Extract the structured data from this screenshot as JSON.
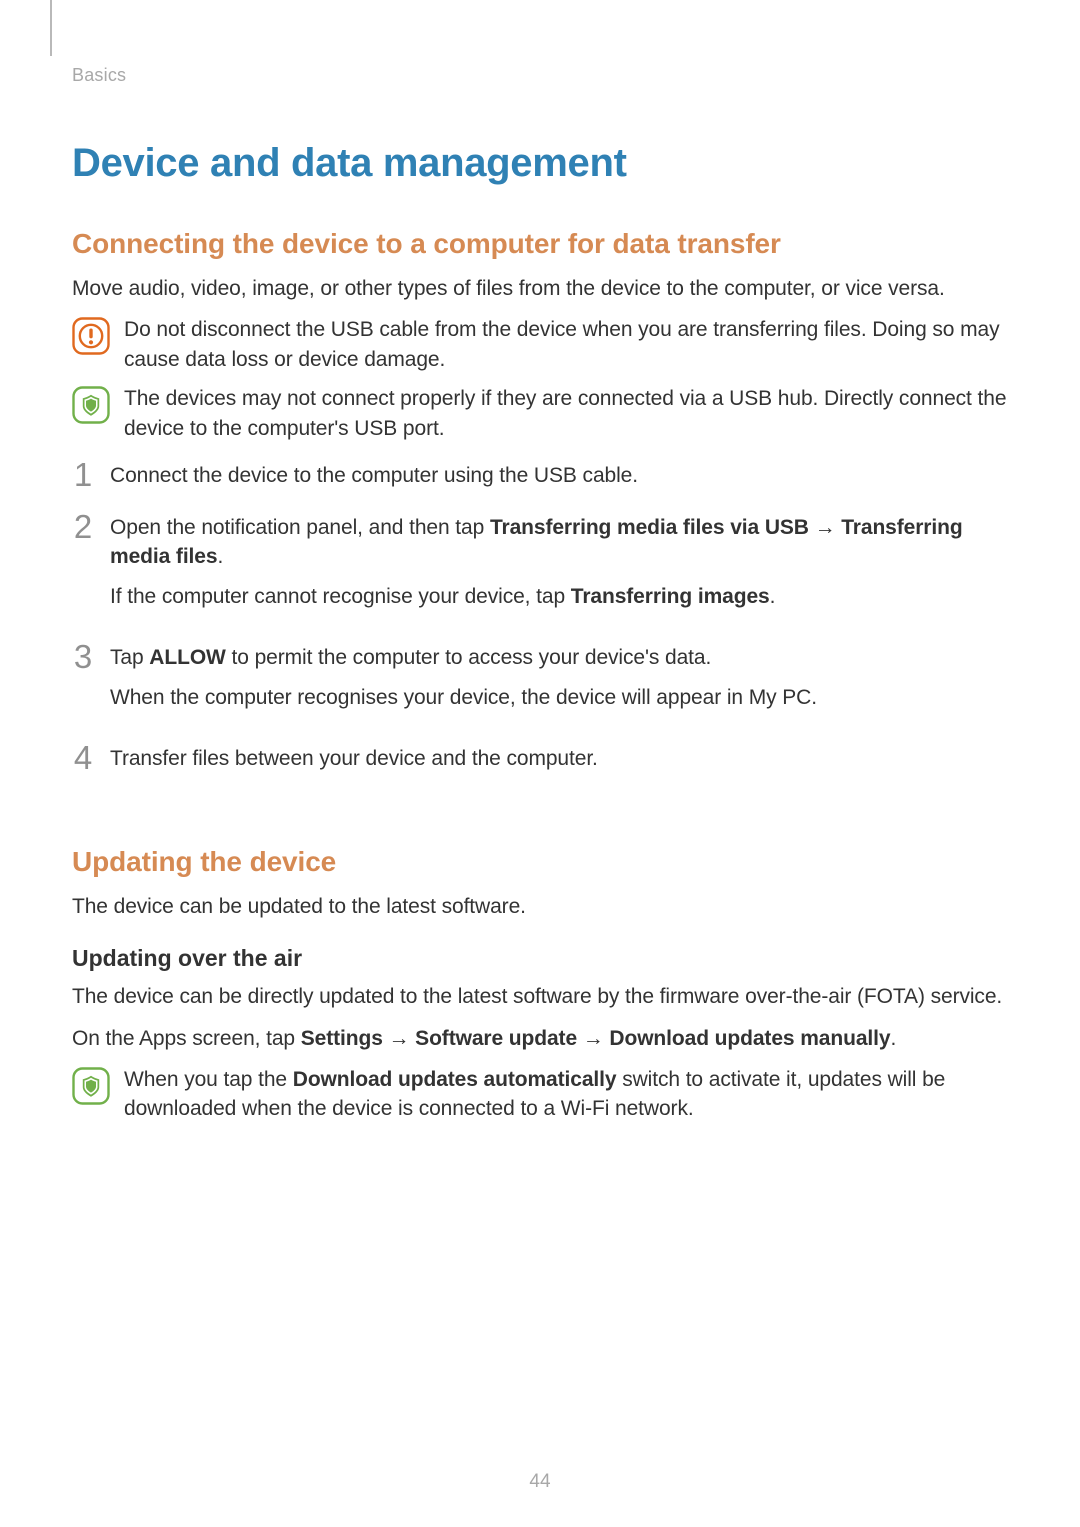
{
  "header": {
    "breadcrumb": "Basics"
  },
  "title": "Device and data management",
  "section1": {
    "heading": "Connecting the device to a computer for data transfer",
    "intro": "Move audio, video, image, or other types of files from the device to the computer, or vice versa.",
    "warning": "Do not disconnect the USB cable from the device when you are transferring files. Doing so may cause data loss or device damage.",
    "info": "The devices may not connect properly if they are connected via a USB hub. Directly connect the device to the computer's USB port.",
    "steps": {
      "s1": "Connect the device to the computer using the USB cable.",
      "s2a": "Open the notification panel, and then tap ",
      "s2b": "Transferring media files via USB",
      "s2arrow": " → ",
      "s2c": "Transferring media files",
      "s2d": ".",
      "s2note_a": "If the computer cannot recognise your device, tap ",
      "s2note_b": "Transferring images",
      "s2note_c": ".",
      "s3a": "Tap ",
      "s3b": "ALLOW",
      "s3c": " to permit the computer to access your device's data.",
      "s3note": "When the computer recognises your device, the device will appear in My PC.",
      "s4": "Transfer files between your device and the computer."
    }
  },
  "section2": {
    "heading": "Updating the device",
    "intro": "The device can be updated to the latest software.",
    "sub1": {
      "heading": "Updating over the air",
      "p1": "The device can be directly updated to the latest software by the firmware over-the-air (FOTA) service.",
      "p2a": "On the Apps screen, tap ",
      "p2b": "Settings",
      "p2arrow1": " → ",
      "p2c": "Software update",
      "p2arrow2": " → ",
      "p2d": "Download updates manually",
      "p2e": ".",
      "info_a": "When you tap the ",
      "info_b": "Download updates automatically",
      "info_c": " switch to activate it, updates will be downloaded when the device is connected to a Wi-Fi network."
    }
  },
  "pageNumber": "44",
  "numbers": {
    "n1": "1",
    "n2": "2",
    "n3": "3",
    "n4": "4"
  }
}
